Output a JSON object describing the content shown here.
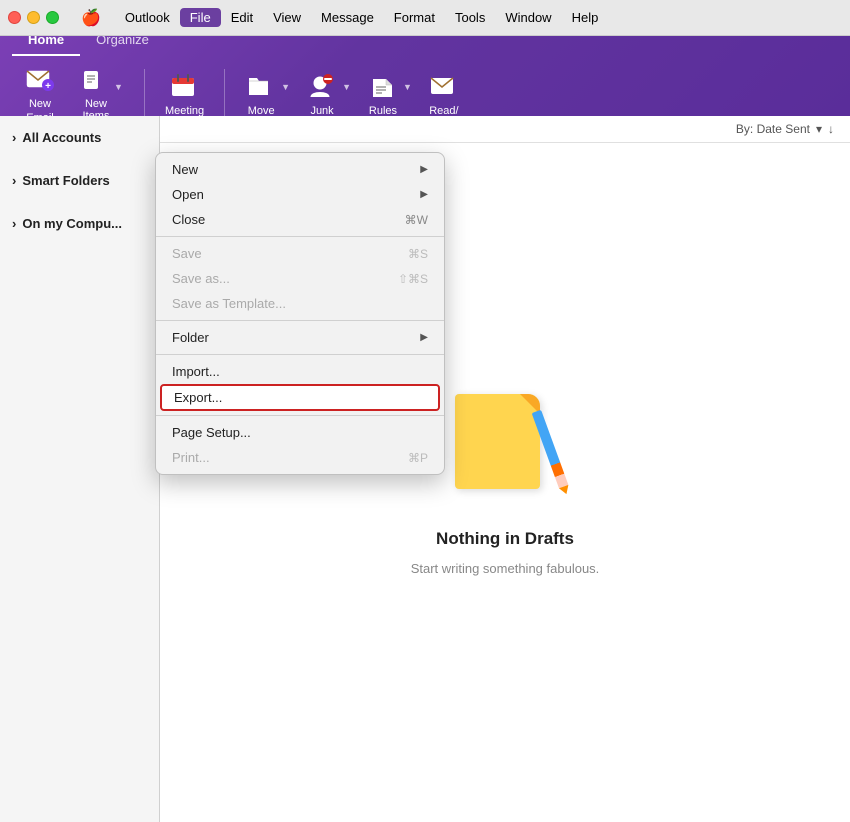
{
  "menubar": {
    "apple": "🍎",
    "items": [
      {
        "id": "outlook",
        "label": "Outlook"
      },
      {
        "id": "file",
        "label": "File",
        "active": true
      },
      {
        "id": "edit",
        "label": "Edit"
      },
      {
        "id": "view",
        "label": "View"
      },
      {
        "id": "message",
        "label": "Message"
      },
      {
        "id": "format",
        "label": "Format"
      },
      {
        "id": "tools",
        "label": "Tools"
      },
      {
        "id": "window",
        "label": "Window"
      },
      {
        "id": "help",
        "label": "Help"
      }
    ]
  },
  "toolbar": {
    "tabs": [
      {
        "id": "home",
        "label": "Home",
        "active": true
      },
      {
        "id": "organize",
        "label": "Organize"
      }
    ],
    "buttons": [
      {
        "id": "new-email",
        "label": "New\nEmail",
        "icon": "✉"
      },
      {
        "id": "new-items",
        "label": "New\nItems",
        "icon": "📋",
        "hasDropdown": true
      },
      {
        "id": "meeting",
        "label": "Meeting",
        "icon": "📅"
      },
      {
        "id": "move",
        "label": "Move",
        "icon": "📁",
        "hasDropdown": true
      },
      {
        "id": "junk",
        "label": "Junk",
        "icon": "👤",
        "hasDropdown": true,
        "hasBadge": true
      },
      {
        "id": "rules",
        "label": "Rules",
        "icon": "📋",
        "hasDropdown": true
      },
      {
        "id": "read",
        "label": "Read/",
        "icon": "✉"
      }
    ]
  },
  "file_menu": {
    "items": [
      {
        "id": "new",
        "label": "New",
        "hasSubmenu": true
      },
      {
        "id": "open",
        "label": "Open",
        "hasSubmenu": true
      },
      {
        "id": "close",
        "label": "Close",
        "shortcut": "⌘W"
      },
      {
        "id": "sep1"
      },
      {
        "id": "save",
        "label": "Save",
        "shortcut": "⌘S",
        "disabled": true
      },
      {
        "id": "save-as",
        "label": "Save as...",
        "shortcut": "⇧⌘S",
        "disabled": true
      },
      {
        "id": "save-as-template",
        "label": "Save as Template...",
        "disabled": true
      },
      {
        "id": "sep2"
      },
      {
        "id": "folder",
        "label": "Folder",
        "hasSubmenu": true
      },
      {
        "id": "sep3"
      },
      {
        "id": "import",
        "label": "Import..."
      },
      {
        "id": "export",
        "label": "Export...",
        "highlighted": true
      },
      {
        "id": "sep4"
      },
      {
        "id": "page-setup",
        "label": "Page Setup..."
      },
      {
        "id": "print",
        "label": "Print...",
        "shortcut": "⌘P",
        "disabled": true
      }
    ]
  },
  "sidebar": {
    "sections": [
      {
        "id": "all-accounts",
        "label": "All Accounts",
        "bold": true,
        "chevron": "›"
      },
      {
        "id": "smart-folders",
        "label": "Smart Folders",
        "chevron": "›"
      },
      {
        "id": "on-my-computer",
        "label": "On my Compu...",
        "chevron": "›"
      }
    ]
  },
  "content": {
    "sort_label": "By: Date Sent",
    "sort_icon": "↓",
    "empty_title": "Nothing in Drafts",
    "empty_subtitle": "Start writing something fabulous."
  }
}
